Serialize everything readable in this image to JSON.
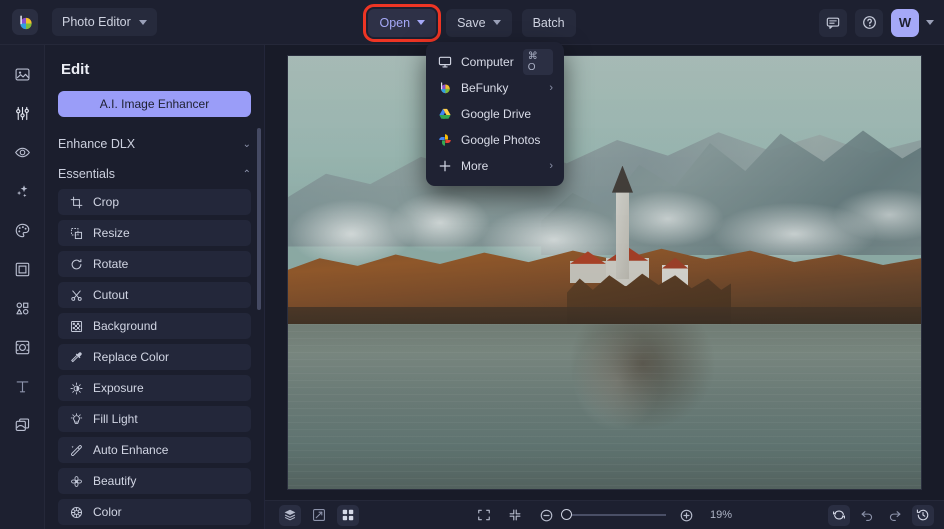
{
  "app": {
    "logo_icon": "befunky-logo-icon",
    "switcher_label": "Photo Editor",
    "switcher_chevron_icon": "chevron-down-icon"
  },
  "toolbar": {
    "open_label": "Open",
    "open_chevron_icon": "chevron-down-icon",
    "save_label": "Save",
    "save_chevron_icon": "chevron-down-icon",
    "batch_label": "Batch",
    "highlight_color": "#ee3524",
    "accent_color": "#9a9df8"
  },
  "header_right": {
    "feedback_icon": "chat-bubble-icon",
    "help_icon": "question-circle-icon",
    "avatar_initial": "W",
    "avatar_chevron_icon": "chevron-down-icon"
  },
  "open_menu": {
    "items": [
      {
        "label": "Computer",
        "icon": "monitor-icon",
        "shortcut": "⌘ O",
        "arrow": ""
      },
      {
        "label": "BeFunky",
        "icon": "befunky-logo-icon",
        "shortcut": "",
        "arrow": "›"
      },
      {
        "label": "Google Drive",
        "icon": "google-drive-icon",
        "shortcut": "",
        "arrow": ""
      },
      {
        "label": "Google Photos",
        "icon": "google-photos-icon",
        "shortcut": "",
        "arrow": ""
      },
      {
        "label": "More",
        "icon": "plus-icon",
        "shortcut": "",
        "arrow": "›"
      }
    ]
  },
  "rail": {
    "items": [
      {
        "name": "image-icon",
        "title": "Image"
      },
      {
        "name": "sliders-icon",
        "title": "Edit"
      },
      {
        "name": "eye-icon",
        "title": "Retouch"
      },
      {
        "name": "sparkles-icon",
        "title": "Effects"
      },
      {
        "name": "palette-icon",
        "title": "Artsy"
      },
      {
        "name": "frame-icon",
        "title": "Frames"
      },
      {
        "name": "shapes-icon",
        "title": "Graphics"
      },
      {
        "name": "overlay-icon",
        "title": "Overlays"
      },
      {
        "name": "text-icon",
        "title": "Text"
      },
      {
        "name": "textures-icon",
        "title": "Textures"
      }
    ]
  },
  "panel": {
    "title": "Edit",
    "enhancer_label": "A.I. Image Enhancer",
    "sections": [
      {
        "label": "Enhance DLX",
        "expanded": false,
        "caret": "⌄"
      },
      {
        "label": "Essentials",
        "expanded": true,
        "caret": "⌃"
      }
    ],
    "essentials": [
      {
        "label": "Crop",
        "icon": "crop-icon"
      },
      {
        "label": "Resize",
        "icon": "resize-icon"
      },
      {
        "label": "Rotate",
        "icon": "rotate-icon"
      },
      {
        "label": "Cutout",
        "icon": "scissors-icon"
      },
      {
        "label": "Background",
        "icon": "checkerboard-icon"
      },
      {
        "label": "Replace Color",
        "icon": "eyedropper-icon"
      },
      {
        "label": "Exposure",
        "icon": "brightness-icon"
      },
      {
        "label": "Fill Light",
        "icon": "bulb-icon"
      },
      {
        "label": "Auto Enhance",
        "icon": "magic-wand-icon"
      },
      {
        "label": "Beautify",
        "icon": "flower-icon"
      },
      {
        "label": "Color",
        "icon": "color-wheel-icon"
      }
    ]
  },
  "canvas": {
    "image_alt": "Lake Bled island church with autumn forest and mountains reflected in lake"
  },
  "bottombar": {
    "layers_icon": "layers-icon",
    "compare_icon": "compare-icon",
    "grid_icon": "grid-icon",
    "fit_icon": "fit-to-screen-icon",
    "actual_icon": "collapse-icon",
    "zoom_out_icon": "zoom-out-icon",
    "zoom_in_icon": "zoom-in-icon",
    "zoom_level": "19%",
    "reset_icon": "reset-icon",
    "undo_icon": "undo-icon",
    "redo_icon": "redo-icon",
    "history_icon": "history-icon"
  }
}
